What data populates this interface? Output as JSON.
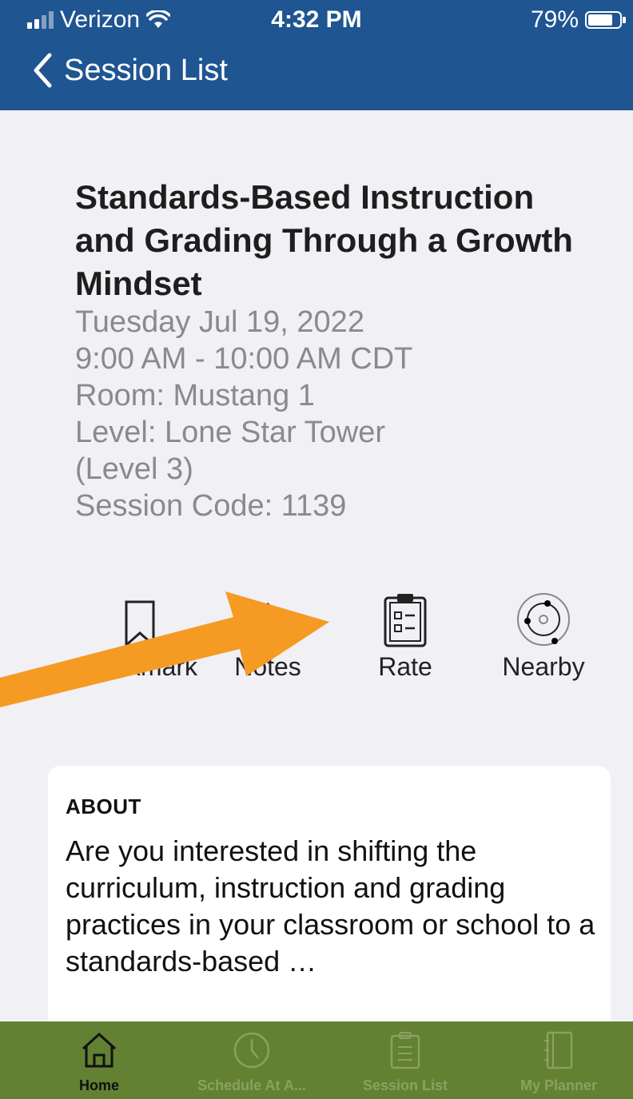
{
  "status": {
    "carrier": "Verizon",
    "time": "4:32 PM",
    "battery": "79%",
    "battery_level": 0.79
  },
  "nav": {
    "back_label": "Session List"
  },
  "session": {
    "title": "Standards-Based Instruction and Grading Through a Growth Mindset",
    "date": "Tuesday Jul 19, 2022",
    "time": "9:00 AM - 10:00 AM CDT",
    "room": "Room: Mustang 1",
    "level": "Level: Lone Star Tower\n(Level 3)",
    "code": "Session Code: 1139"
  },
  "actions": [
    {
      "label": "Bookmark",
      "icon": "bookmark-icon"
    },
    {
      "label": "Notes",
      "icon": "notes-icon"
    },
    {
      "label": "Rate",
      "icon": "clipboard-icon"
    },
    {
      "label": "Nearby",
      "icon": "nearby-icon"
    }
  ],
  "about": {
    "heading": "ABOUT",
    "text": "Are you interested in shifting the curriculum, instruction and grading practices in your classroom or school to a standards-based …"
  },
  "tabs": [
    {
      "label": "Home",
      "icon": "home-icon",
      "active": true
    },
    {
      "label": "Schedule At A...",
      "icon": "clock-icon",
      "active": false
    },
    {
      "label": "Session List",
      "icon": "clipboard-icon",
      "active": false
    },
    {
      "label": "My Planner",
      "icon": "notebook-icon",
      "active": false
    }
  ],
  "colors": {
    "header": "#1f5591",
    "tabbar": "#638132",
    "arrow": "#f59a23",
    "background": "#f1f0f5"
  }
}
